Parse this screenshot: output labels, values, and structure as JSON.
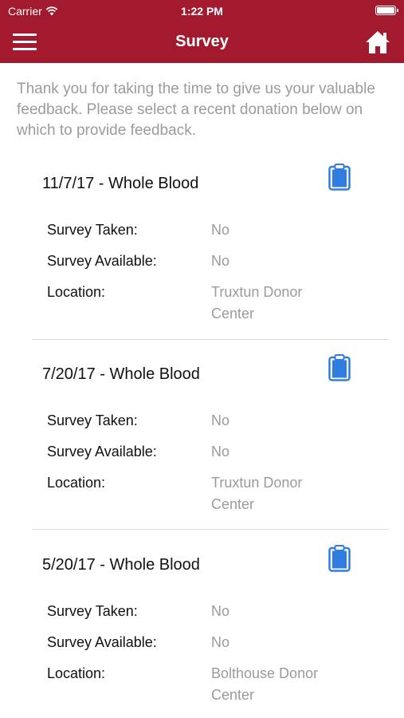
{
  "status_bar": {
    "carrier": "Carrier",
    "time": "1:22 PM"
  },
  "nav": {
    "title": "Survey",
    "menu_icon": "hamburger-menu-icon",
    "home_icon": "home-icon"
  },
  "intro": "Thank you for taking the time to give us your valuable feedback. Please select a recent donation below on which to provide feedback.",
  "labels": {
    "survey_taken": "Survey Taken:",
    "survey_available": "Survey Available:",
    "location": "Location:"
  },
  "donations": [
    {
      "title": "11/7/17 - Whole Blood",
      "survey_taken": "No",
      "survey_available": "No",
      "location": "Truxtun Donor Center"
    },
    {
      "title": "7/20/17 - Whole Blood",
      "survey_taken": "No",
      "survey_available": "No",
      "location": "Truxtun Donor Center"
    },
    {
      "title": "5/20/17 - Whole Blood",
      "survey_taken": "No",
      "survey_available": "No",
      "location": "Bolthouse Donor Center"
    }
  ],
  "colors": {
    "brand": "#a31a2f",
    "clipboard": "#2f7de1",
    "muted": "#9b9b9b"
  }
}
